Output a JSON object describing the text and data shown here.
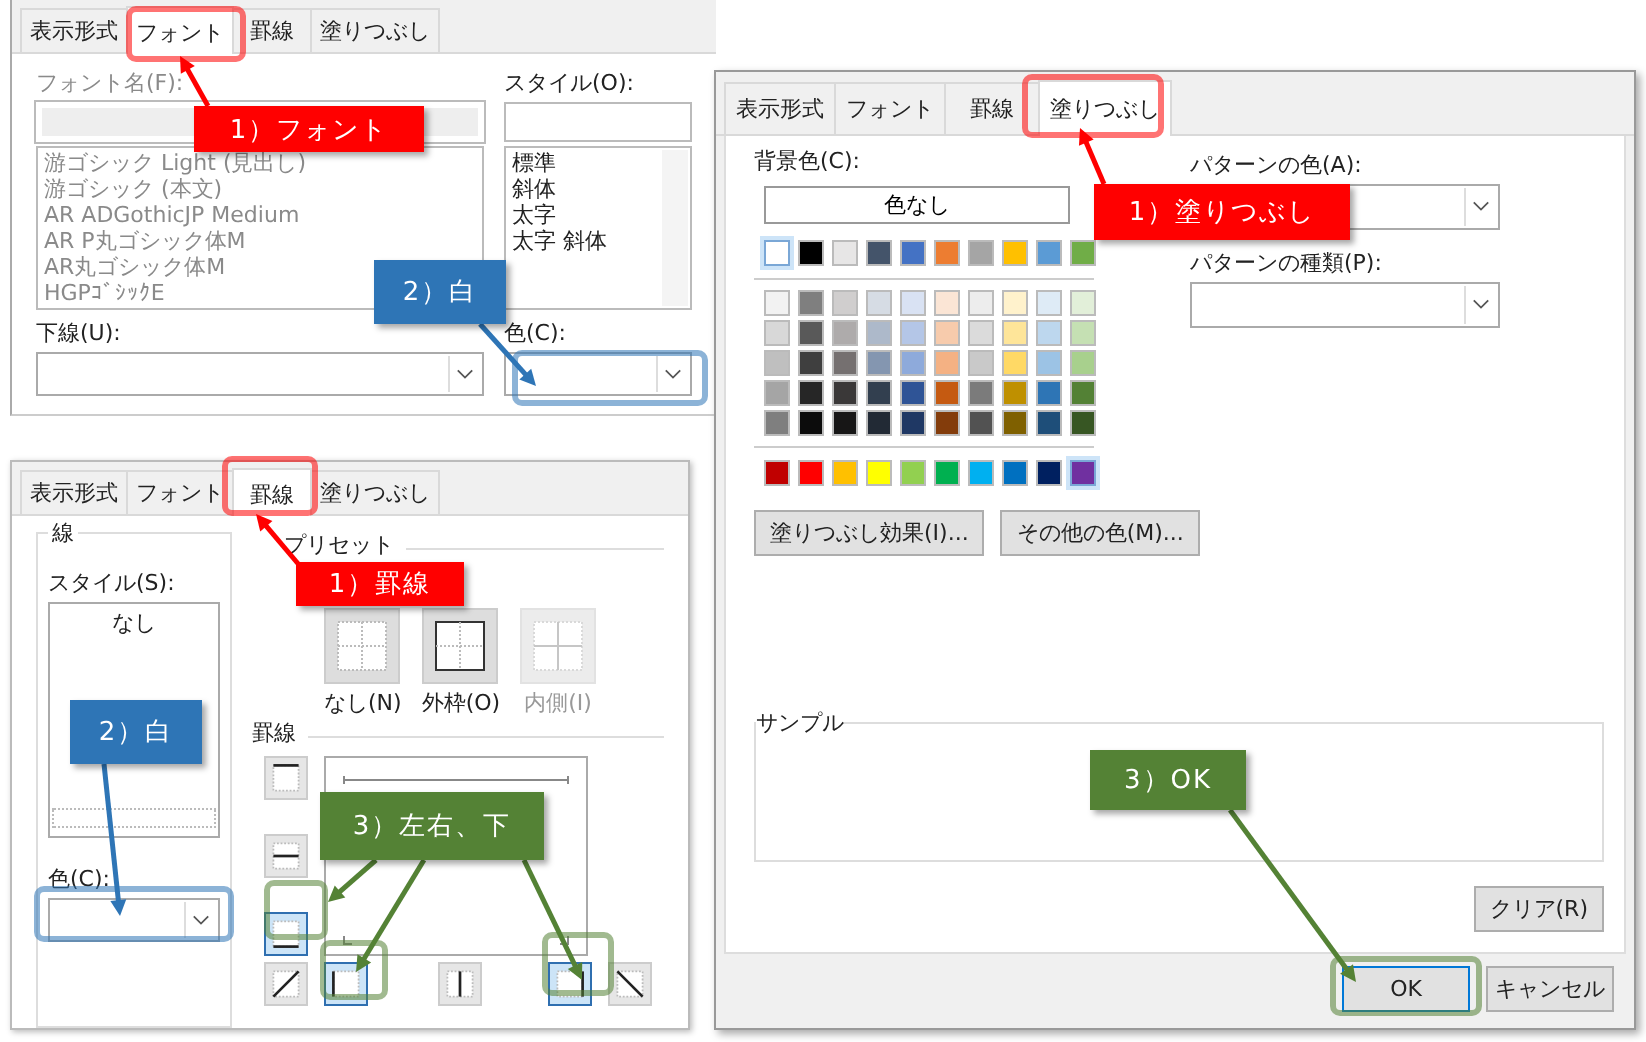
{
  "font_dialog": {
    "tabs": [
      {
        "label": "表示形式",
        "selected": false
      },
      {
        "label": "フォント",
        "selected": true
      },
      {
        "label": "罫線",
        "selected": false
      },
      {
        "label": "塗りつぶし",
        "selected": false
      }
    ],
    "font_name_label": "フォント名(F):",
    "fonts": [
      "游ゴシック Light (見出し)",
      "游ゴシック (本文)",
      "AR ADGothicJP Medium",
      "AR P丸ゴシック体M",
      "AR丸ゴシック体M",
      "HGPｺﾞｼｯｸE"
    ],
    "style_label": "スタイル(O):",
    "styles": [
      "標準",
      "斜体",
      "太字",
      "太字 斜体"
    ],
    "underline_label": "下線(U):",
    "color_label": "色(C):"
  },
  "border_dialog": {
    "tabs": [
      {
        "label": "表示形式",
        "selected": false
      },
      {
        "label": "フォント",
        "selected": false
      },
      {
        "label": "罫線",
        "selected": true
      },
      {
        "label": "塗りつぶし",
        "selected": false
      }
    ],
    "line_group": "線",
    "style_label": "スタイル(S):",
    "line_styles": [
      "なし"
    ],
    "color_label": "色(C):",
    "preset_label": "プリセット",
    "presets": [
      {
        "kind": "none",
        "label": "なし(N)",
        "disabled": false
      },
      {
        "kind": "outline",
        "label": "外枠(O)",
        "disabled": false
      },
      {
        "kind": "inside",
        "label": "内側(I)",
        "disabled": true
      }
    ],
    "border_label": "罫線",
    "side_buttons": [
      {
        "kind": "top",
        "selected": false
      },
      {
        "kind": "inside_h",
        "selected": false
      },
      {
        "kind": "bottom",
        "selected": true
      }
    ],
    "bottom_buttons": [
      {
        "kind": "diag_up",
        "selected": false
      },
      {
        "kind": "left",
        "selected": true
      },
      {
        "kind": "inside_v",
        "selected": false
      },
      {
        "kind": "right",
        "selected": true
      },
      {
        "kind": "diag_down",
        "selected": false
      }
    ]
  },
  "fill_dialog": {
    "tabs": [
      {
        "label": "表示形式",
        "selected": false
      },
      {
        "label": "フォント",
        "selected": false
      },
      {
        "label": "罫線",
        "selected": false
      },
      {
        "label": "塗りつぶし",
        "selected": true
      }
    ],
    "background_label": "背景色(C):",
    "no_color_button": "色なし",
    "theme_row": [
      {
        "color": "#ffffff",
        "selected": true
      },
      {
        "color": "#000000",
        "selected": false
      },
      {
        "color": "#e7e6e6",
        "selected": false
      },
      {
        "color": "#44546a",
        "selected": false
      },
      {
        "color": "#4472c4",
        "selected": false
      },
      {
        "color": "#ed7d31",
        "selected": false
      },
      {
        "color": "#a5a5a5",
        "selected": false
      },
      {
        "color": "#ffc000",
        "selected": false
      },
      {
        "color": "#5b9bd5",
        "selected": false
      },
      {
        "color": "#70ad47",
        "selected": false
      }
    ],
    "tint_rows": [
      [
        {
          "color": "#f2f2f2",
          "selected": false
        },
        {
          "color": "#7f7f7f",
          "selected": false
        },
        {
          "color": "#d0cece",
          "selected": false
        },
        {
          "color": "#d6dce4",
          "selected": false
        },
        {
          "color": "#d9e2f3",
          "selected": false
        },
        {
          "color": "#fbe5d5",
          "selected": false
        },
        {
          "color": "#ededed",
          "selected": false
        },
        {
          "color": "#fff2cc",
          "selected": false
        },
        {
          "color": "#deebf6",
          "selected": false
        },
        {
          "color": "#e2efd9",
          "selected": false
        }
      ],
      [
        {
          "color": "#d8d8d8",
          "selected": false
        },
        {
          "color": "#595959",
          "selected": false
        },
        {
          "color": "#aeabab",
          "selected": false
        },
        {
          "color": "#adb9ca",
          "selected": false
        },
        {
          "color": "#b4c6e7",
          "selected": false
        },
        {
          "color": "#f7cbac",
          "selected": false
        },
        {
          "color": "#dbdbdb",
          "selected": false
        },
        {
          "color": "#fee599",
          "selected": false
        },
        {
          "color": "#bdd7ee",
          "selected": false
        },
        {
          "color": "#c5e0b3",
          "selected": false
        }
      ],
      [
        {
          "color": "#bfbfbf",
          "selected": false
        },
        {
          "color": "#3f3f3f",
          "selected": false
        },
        {
          "color": "#757070",
          "selected": false
        },
        {
          "color": "#8496b0",
          "selected": false
        },
        {
          "color": "#8eaadb",
          "selected": false
        },
        {
          "color": "#f4b183",
          "selected": false
        },
        {
          "color": "#c9c9c9",
          "selected": false
        },
        {
          "color": "#ffd965",
          "selected": false
        },
        {
          "color": "#9cc3e5",
          "selected": false
        },
        {
          "color": "#a8d08d",
          "selected": false
        }
      ],
      [
        {
          "color": "#a5a5a5",
          "selected": false
        },
        {
          "color": "#262626",
          "selected": false
        },
        {
          "color": "#3a3838",
          "selected": false
        },
        {
          "color": "#323f4f",
          "selected": false
        },
        {
          "color": "#2f5496",
          "selected": false
        },
        {
          "color": "#c55a11",
          "selected": false
        },
        {
          "color": "#7b7b7b",
          "selected": false
        },
        {
          "color": "#bf9000",
          "selected": false
        },
        {
          "color": "#2e75b5",
          "selected": false
        },
        {
          "color": "#538135",
          "selected": false
        }
      ],
      [
        {
          "color": "#7f7f7f",
          "selected": false
        },
        {
          "color": "#0c0c0c",
          "selected": false
        },
        {
          "color": "#171616",
          "selected": false
        },
        {
          "color": "#222a35",
          "selected": false
        },
        {
          "color": "#1f3864",
          "selected": false
        },
        {
          "color": "#833c0b",
          "selected": false
        },
        {
          "color": "#525252",
          "selected": false
        },
        {
          "color": "#7f6000",
          "selected": false
        },
        {
          "color": "#1e4e79",
          "selected": false
        },
        {
          "color": "#375623",
          "selected": false
        }
      ]
    ],
    "standard_row": [
      {
        "color": "#c00000",
        "selected": false
      },
      {
        "color": "#ff0000",
        "selected": false
      },
      {
        "color": "#ffc000",
        "selected": false
      },
      {
        "color": "#ffff00",
        "selected": false
      },
      {
        "color": "#92d050",
        "selected": false
      },
      {
        "color": "#00b050",
        "selected": false
      },
      {
        "color": "#00b0f0",
        "selected": false
      },
      {
        "color": "#0070c0",
        "selected": false
      },
      {
        "color": "#002060",
        "selected": false
      },
      {
        "color": "#7030a0",
        "selected": true
      }
    ],
    "effects_button": "塗りつぶし効果(I)...",
    "more_colors_button": "その他の色(M)...",
    "pattern_color_label": "パターンの色(A):",
    "pattern_style_label": "パターンの種類(P):",
    "sample_label": "サンプル",
    "clear_button": "クリア(R)",
    "ok_button": "OK",
    "cancel_button": "キャンセル"
  },
  "callouts": [
    {
      "text": "1）フォント",
      "color": "#ff0000"
    },
    {
      "text": "2）白",
      "color": "#2e75b6"
    },
    {
      "text": "1）罫線",
      "color": "#ff0000"
    },
    {
      "text": "2）白",
      "color": "#2e75b6"
    },
    {
      "text": "3）左右、下",
      "color": "#548235"
    },
    {
      "text": "1）塗りつぶし",
      "color": "#ff0000"
    },
    {
      "text": "3）OK",
      "color": "#548235"
    }
  ]
}
